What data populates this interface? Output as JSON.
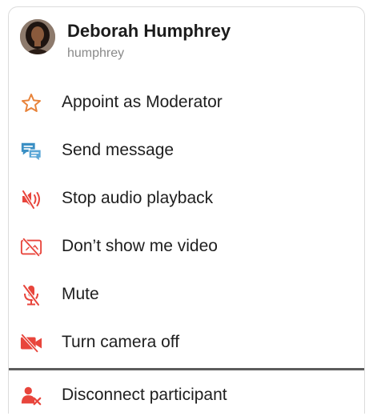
{
  "participant": {
    "name": "Deborah Humphrey",
    "username": "humphrey"
  },
  "colors": {
    "accent_red": "#e8453c",
    "star_orange": "#e8833a",
    "message_blue": "#3a8fc4"
  },
  "menu": {
    "items": [
      {
        "label": "Appoint as Moderator",
        "icon": "star-outline-icon"
      },
      {
        "label": "Send message",
        "icon": "chat-bubbles-icon"
      },
      {
        "label": "Stop audio playback",
        "icon": "speaker-muted-icon"
      },
      {
        "label": "Don’t show me video",
        "icon": "video-hidden-icon"
      },
      {
        "label": "Mute",
        "icon": "microphone-off-icon"
      },
      {
        "label": "Turn camera off",
        "icon": "camera-off-icon"
      }
    ],
    "disconnect": {
      "label": "Disconnect participant",
      "icon": "remove-user-icon"
    }
  }
}
